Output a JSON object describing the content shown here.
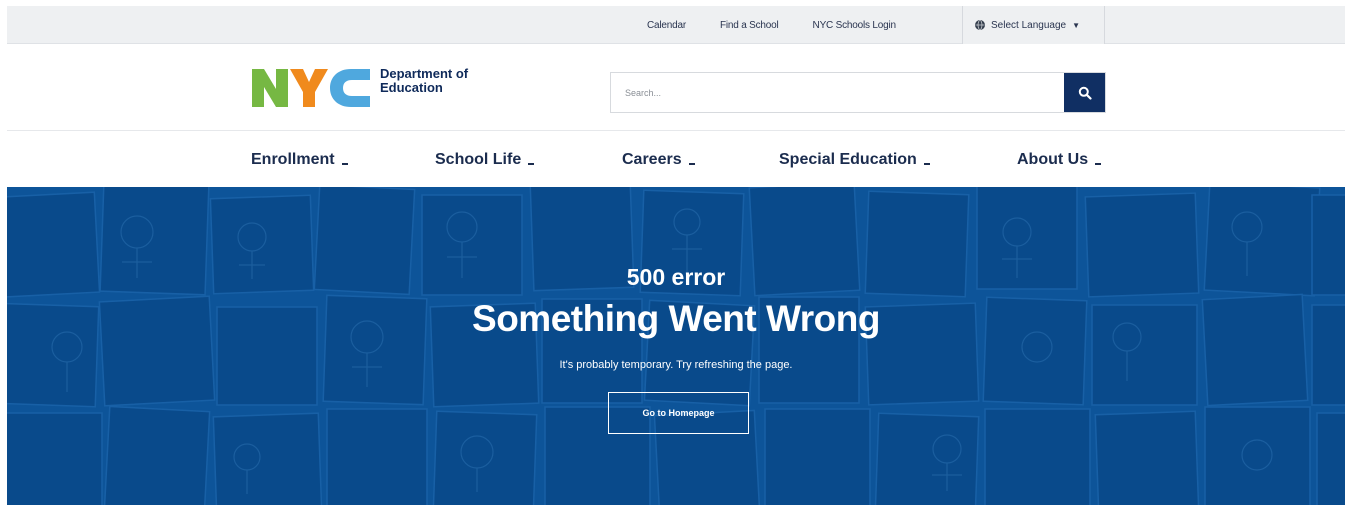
{
  "utility": {
    "links": [
      "Calendar",
      "Find a School",
      "NYC Schools Login"
    ],
    "language_label": "Select Language"
  },
  "header": {
    "logo_letters": "NYC",
    "logo_line1": "Department of",
    "logo_line2": "Education",
    "search_placeholder": "Search..."
  },
  "nav": {
    "items": [
      "Enrollment",
      "School Life",
      "Careers",
      "Special Education",
      "About Us"
    ]
  },
  "hero": {
    "code": "500 error",
    "title": "Something Went Wrong",
    "subtitle": "It's probably temporary. Try refreshing the page.",
    "button_label": "Go to Homepage"
  },
  "colors": {
    "brand_navy": "#102f63",
    "hero_blue": "#0d5499",
    "logo_green": "#76b843",
    "logo_orange": "#f08a1d",
    "logo_lightblue": "#4fa8de"
  },
  "icons": {
    "search": "search-icon",
    "globe": "globe-icon",
    "caret": "caret-down-icon"
  }
}
